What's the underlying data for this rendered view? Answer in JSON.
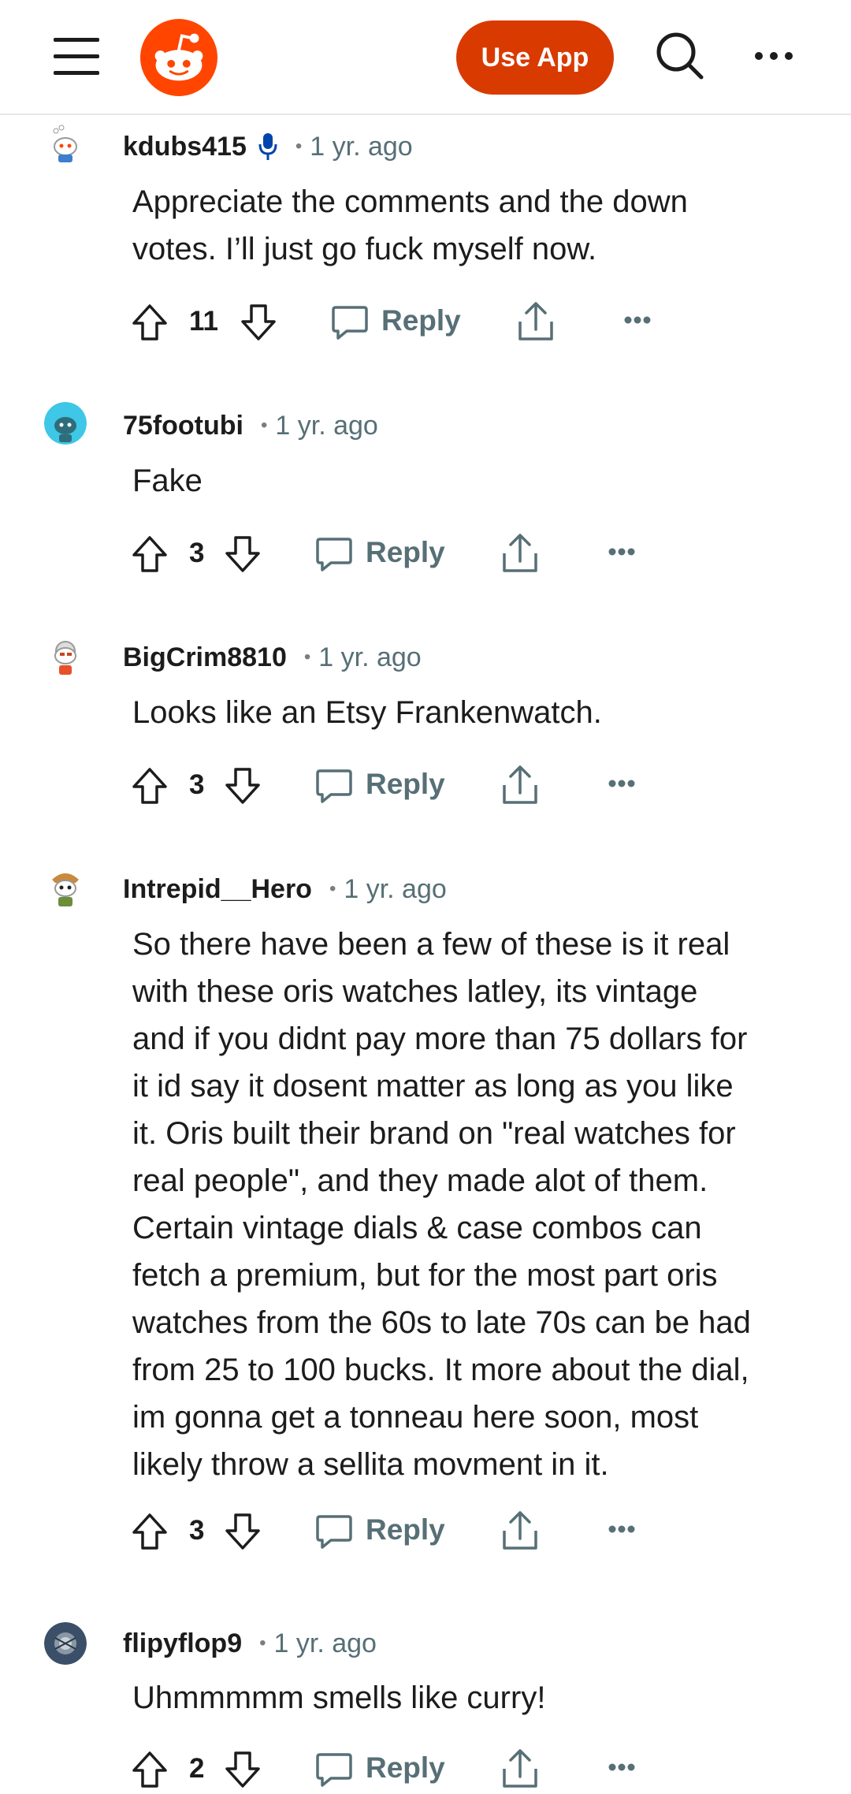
{
  "header": {
    "use_app_label": "Use App",
    "brand_color": "#d93a00",
    "icons": [
      "menu-icon",
      "reddit-logo",
      "search-icon",
      "more-icon"
    ]
  },
  "comments": [
    {
      "username": "kdubs415",
      "has_mic_badge": true,
      "time": "1 yr. ago",
      "body": "Appreciate the comments and the down\nvotes. I’ll just go fuck myself now.",
      "votes": "11",
      "reply_label": "Reply"
    },
    {
      "username": "75footubi",
      "time": "1 yr. ago",
      "body": "Fake",
      "votes": "3",
      "reply_label": "Reply"
    },
    {
      "username": "BigCrim8810",
      "time": "1 yr. ago",
      "body": "Looks like an Etsy Frankenwatch.",
      "votes": "3",
      "reply_label": "Reply"
    },
    {
      "username": "Intrepid__Hero",
      "time": "1 yr. ago",
      "body": "So there have been a few of these is it real\nwith these oris watches latley, its vintage\nand if you didnt pay more than 75 dollars for\nit id say it dosent matter as long as you like\nit. Oris built their brand on \"real watches for\nreal people\", and they made alot of them.\nCertain vintage dials & case combos can\nfetch a premium, but for the most part oris\nwatches from the 60s to late 70s can be had\nfrom 25 to 100 bucks. It more about the dial,\nim gonna get a tonneau here soon, most\nlikely throw a sellita movment in it.",
      "votes": "3",
      "reply_label": "Reply"
    },
    {
      "username": "flipyflop9",
      "time": "1 yr. ago",
      "body": "Uhmmmmm smells like curry!",
      "votes": "2",
      "reply_label": "Reply"
    }
  ]
}
